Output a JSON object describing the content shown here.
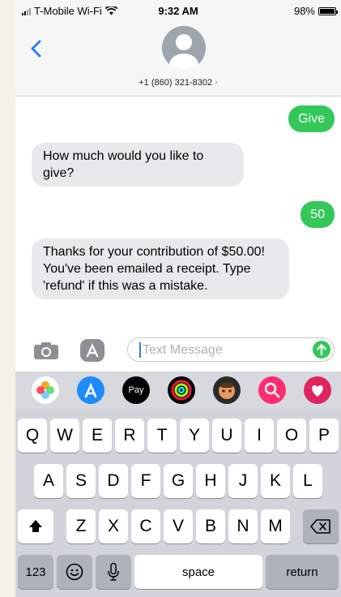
{
  "status_bar": {
    "carrier": "T-Mobile Wi-Fi",
    "time": "9:32 AM",
    "battery_percent": "98%",
    "battery_level": 0.98
  },
  "header": {
    "contact_number": "+1 (860) 321-8302",
    "contact_chevron": "›"
  },
  "messages": [
    {
      "direction": "outgoing",
      "text": "Give"
    },
    {
      "direction": "incoming",
      "text": "How much would you like to give?"
    },
    {
      "direction": "outgoing",
      "text": "50"
    },
    {
      "direction": "incoming",
      "text": "Thanks for your contribution of $50.00!  You've been emailed a receipt.  Type 'refund' if this was a mistake."
    }
  ],
  "input": {
    "placeholder": "Text Message",
    "apple_pay_label": "Pay"
  },
  "keyboard": {
    "row1": [
      "Q",
      "W",
      "E",
      "R",
      "T",
      "Y",
      "U",
      "I",
      "O",
      "P"
    ],
    "row2": [
      "A",
      "S",
      "D",
      "F",
      "G",
      "H",
      "J",
      "K",
      "L"
    ],
    "row3": [
      "Z",
      "X",
      "C",
      "V",
      "B",
      "N",
      "M"
    ],
    "numbers_key": "123",
    "space_key": "space",
    "return_key": "return"
  },
  "colors": {
    "imessage_green": "#34c759",
    "incoming_bubble": "#e9e9eb",
    "ios_blue": "#2f7cf6"
  },
  "icons": [
    "wifi-icon",
    "back-chevron-icon",
    "avatar-icon",
    "camera-icon",
    "app-store-icon",
    "send-arrow-icon",
    "photos-icon",
    "apple-pay-icon",
    "activity-icon",
    "memoji-icon",
    "search-app-icon",
    "heart-app-icon",
    "shift-icon",
    "backspace-icon",
    "emoji-icon",
    "microphone-icon"
  ]
}
